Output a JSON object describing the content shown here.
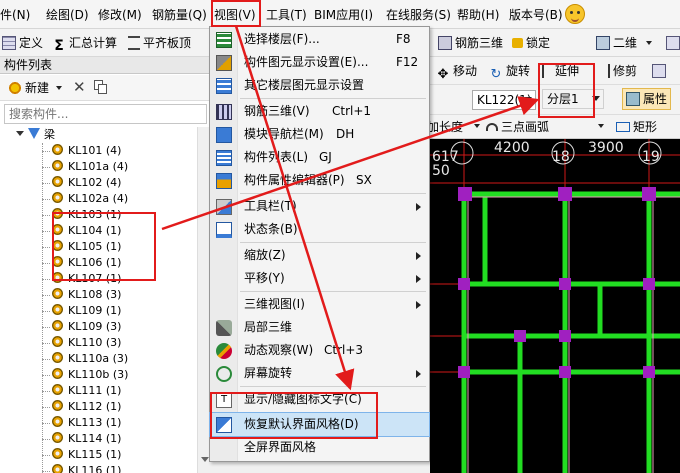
{
  "menubar": {
    "items": [
      {
        "label": "件(N)"
      },
      {
        "label": "绘图(D)"
      },
      {
        "label": "修改(M)"
      },
      {
        "label": "钢筋量(Q)"
      },
      {
        "label": "视图(V)"
      },
      {
        "label": "工具(T)"
      },
      {
        "label": "BIM应用(I)"
      },
      {
        "label": "在线服务(S)"
      },
      {
        "label": "帮助(H)"
      },
      {
        "label": "版本号(B)"
      }
    ]
  },
  "toolbar": {
    "define": "定义",
    "summary": "汇总计算",
    "slab_top": "平齐板顶",
    "rebar3d": "钢筋三维",
    "lock": "锁定",
    "view2d": "二维"
  },
  "panel": {
    "title": "构件列表",
    "new_label": "新建",
    "search_placeholder": "搜索构件...",
    "root": "梁",
    "items": [
      "KL101 (4)",
      "KL101a (4)",
      "KL102 (4)",
      "KL102a (4)",
      "KL103 (1)",
      "KL104 (1)",
      "KL105 (1)",
      "KL106 (1)",
      "KL107 (1)",
      "KL108 (3)",
      "KL109 (1)",
      "KL109 (3)",
      "KL110 (3)",
      "KL110a (3)",
      "KL110b (3)",
      "KL111 (1)",
      "KL112 (1)",
      "KL113 (1)",
      "KL114 (1)",
      "KL115 (1)",
      "KL116 (1)"
    ]
  },
  "right_toolbar": {
    "move": "移动",
    "rotate": "旋转",
    "extend": "延伸",
    "trim": "修剪",
    "beam_combo": "KL122(1)",
    "layer_combo": "分层1",
    "properties": "属性",
    "plus_length": "加长度",
    "three_point_arc": "三点画弧",
    "rectangle": "矩形"
  },
  "view_menu": {
    "items": [
      {
        "label": "选择楼层(F)...",
        "shortcut": "F8",
        "icon": "layers-icon"
      },
      {
        "label": "构件图元显示设置(E)...",
        "shortcut": "F12",
        "icon": "display-settings-icon"
      },
      {
        "label": "其它楼层图元显示设置",
        "shortcut": "",
        "icon": "floors-icon"
      },
      {
        "label": "钢筋三维(V)",
        "shortcut": "Ctrl+1",
        "icon": "rebar-3d-icon"
      },
      {
        "label": "模块导航栏(M)",
        "shortcut": "DH",
        "icon": "nav-bar-icon"
      },
      {
        "label": "构件列表(L)",
        "shortcut": "GJ",
        "icon": "list-icon"
      },
      {
        "label": "构件属性编辑器(P)",
        "shortcut": "SX",
        "icon": "property-editor-icon"
      },
      {
        "label": "工具栏(T)",
        "shortcut": "",
        "icon": "toolbar-icon"
      },
      {
        "label": "状态条(B)",
        "shortcut": "",
        "icon": "statusbar-icon"
      },
      {
        "label": "缩放(Z)",
        "shortcut": "",
        "icon": ""
      },
      {
        "label": "平移(Y)",
        "shortcut": "",
        "icon": ""
      },
      {
        "label": "三维视图(I)",
        "shortcut": "",
        "icon": ""
      },
      {
        "label": "局部三维",
        "shortcut": "",
        "icon": "local-3d-icon"
      },
      {
        "label": "动态观察(W)",
        "shortcut": "Ctrl+3",
        "icon": "orbit-icon"
      },
      {
        "label": "屏幕旋转",
        "shortcut": "",
        "icon": "screen-rotate-icon"
      },
      {
        "label": "显示/隐藏图标文字(C)",
        "shortcut": "",
        "icon": "toggle-text-icon"
      },
      {
        "label": "恢复默认界面风格(D)",
        "shortcut": "",
        "icon": "restore-style-icon"
      },
      {
        "label": "全屏界面风格",
        "shortcut": "",
        "icon": ""
      }
    ]
  },
  "canvas": {
    "axis_labels": [
      "4200",
      "18",
      "3900",
      "19",
      "617",
      "50"
    ]
  },
  "colors": {
    "highlight": "#cce4f7",
    "annotation_red": "#e21b1b",
    "beam_green": "#22dd22",
    "column_purple": "#a020c0",
    "grid_red": "#d01818"
  }
}
